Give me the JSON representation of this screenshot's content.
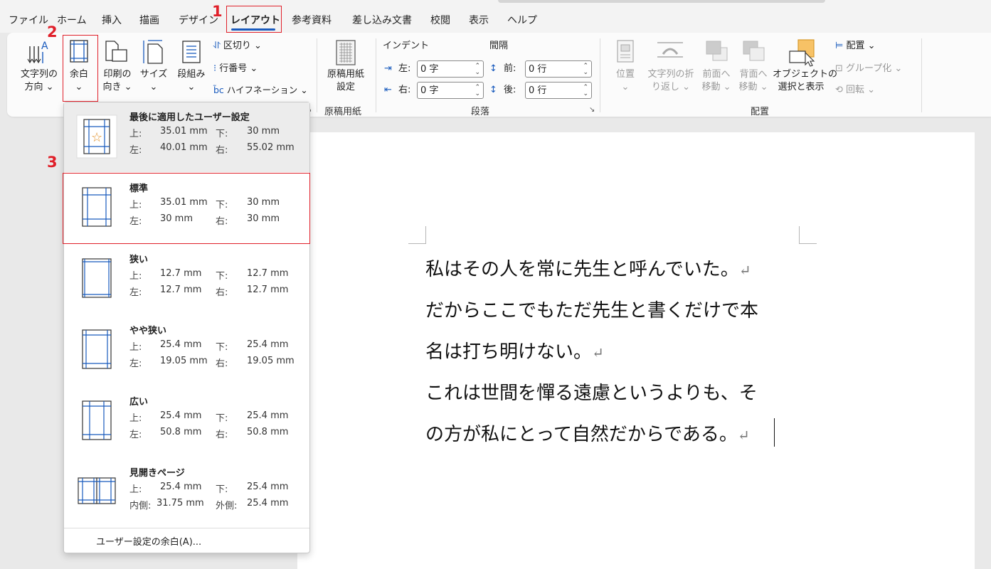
{
  "menu": {
    "tabs": [
      "ファイル",
      "ホーム",
      "挿入",
      "描画",
      "デザイン",
      "レイアウト",
      "参考資料",
      "差し込み文書",
      "校閲",
      "表示",
      "ヘルプ"
    ]
  },
  "ribbon": {
    "text_direction": [
      "文字列の",
      "方向 ⌄"
    ],
    "margins": [
      "余白",
      "⌄"
    ],
    "orientation": [
      "印刷の",
      "向き ⌄"
    ],
    "size": [
      "サイズ",
      "⌄"
    ],
    "columns": [
      "段組み",
      "⌄"
    ],
    "breaks": "区切り ⌄",
    "line_numbers": "行番号 ⌄",
    "hyphenation": "ハイフネーション ⌄",
    "manuscript": [
      "原稿用紙",
      "設定"
    ],
    "manuscript_group": "原稿用紙",
    "indent_label": "インデント",
    "spacing_label": "間隔",
    "indent_left_label": "左:",
    "indent_left_value": "0 字",
    "indent_right_label": "右:",
    "indent_right_value": "0 字",
    "spacing_before_label": "前:",
    "spacing_before_value": "0 行",
    "spacing_after_label": "後:",
    "spacing_after_value": "0 行",
    "paragraph_group": "段落",
    "position": [
      "位置",
      "⌄"
    ],
    "wrap_text": [
      "文字列の折",
      "り返し ⌄"
    ],
    "bring_forward": [
      "前面へ",
      "移動 ⌄"
    ],
    "send_backward": [
      "背面へ",
      "移動 ⌄"
    ],
    "selection_pane": [
      "オブジェクトの",
      "選択と表示"
    ],
    "align": "配置 ⌄",
    "group": "グループ化 ⌄",
    "rotate": "回転 ⌄",
    "arrange_group": "配置"
  },
  "annotations": [
    "1",
    "2",
    "3"
  ],
  "margins_menu": {
    "items": [
      {
        "title": "最後に適用したユーザー設定",
        "l1": "上:",
        "v1": "35.01 mm",
        "l2": "下:",
        "v2": "30 mm",
        "l3": "左:",
        "v3": "40.01 mm",
        "l4": "右:",
        "v4": "55.02 mm"
      },
      {
        "title": "標準",
        "l1": "上:",
        "v1": "35.01 mm",
        "l2": "下:",
        "v2": "30 mm",
        "l3": "左:",
        "v3": "30 mm",
        "l4": "右:",
        "v4": "30 mm"
      },
      {
        "title": "狭い",
        "l1": "上:",
        "v1": "12.7 mm",
        "l2": "下:",
        "v2": "12.7 mm",
        "l3": "左:",
        "v3": "12.7 mm",
        "l4": "右:",
        "v4": "12.7 mm"
      },
      {
        "title": "やや狭い",
        "l1": "上:",
        "v1": "25.4 mm",
        "l2": "下:",
        "v2": "25.4 mm",
        "l3": "左:",
        "v3": "19.05 mm",
        "l4": "右:",
        "v4": "19.05 mm"
      },
      {
        "title": "広い",
        "l1": "上:",
        "v1": "25.4 mm",
        "l2": "下:",
        "v2": "25.4 mm",
        "l3": "左:",
        "v3": "50.8 mm",
        "l4": "右:",
        "v4": "50.8 mm"
      },
      {
        "title": "見開きページ",
        "l1": "上:",
        "v1": "25.4 mm",
        "l2": "下:",
        "v2": "25.4 mm",
        "l3": "内側:",
        "v3": "31.75 mm",
        "l4": "外側:",
        "v4": "25.4 mm"
      }
    ],
    "custom": "ユーザー設定の余白(A)..."
  },
  "document": {
    "lines": [
      "私はその人を常に先生と呼んでいた。",
      "だからここでもただ先生と書くだけで本",
      "名は打ち明けない。",
      "これは世間を憚る遠慮というよりも、そ",
      "の方が私にとって自然だからである。"
    ],
    "return_mark": "↵"
  }
}
